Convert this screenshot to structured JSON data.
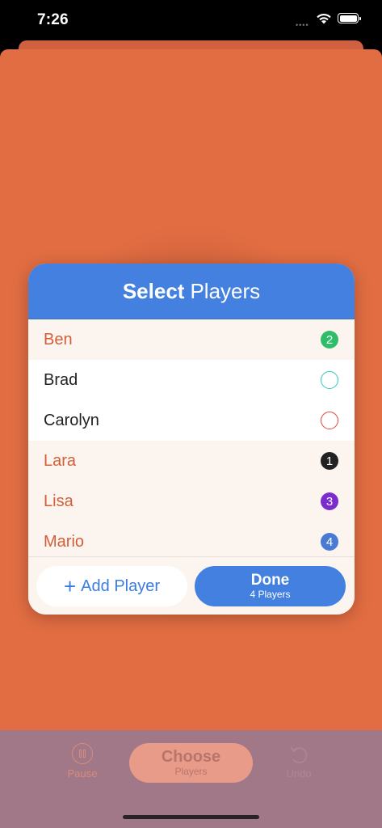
{
  "status": {
    "time": "7:26",
    "signal": "••••"
  },
  "dialog": {
    "title_bold": "Select",
    "title_rest": "Players",
    "players": [
      {
        "name": "Ben",
        "selected": true,
        "badge": "2",
        "badge_color": "#2ebd68"
      },
      {
        "name": "Brad",
        "selected": false,
        "badge": "",
        "badge_color": "#2fc9b8"
      },
      {
        "name": "Carolyn",
        "selected": false,
        "badge": "",
        "badge_color": "#d8443f"
      },
      {
        "name": "Lara",
        "selected": true,
        "badge": "1",
        "badge_color": "#222222"
      },
      {
        "name": "Lisa",
        "selected": true,
        "badge": "3",
        "badge_color": "#7b2ccf"
      },
      {
        "name": "Mario",
        "selected": true,
        "badge": "4",
        "badge_color": "#4a7bd4"
      }
    ],
    "add_player_label": "Add Player",
    "done_label": "Done",
    "done_sub": "4 Players"
  },
  "toolbar": {
    "pause_label": "Pause",
    "choose_label": "Choose",
    "choose_sub": "Players",
    "undo_label": "Undo"
  },
  "colors": {
    "background_card": "#e26d43",
    "accent_blue": "#4380e0",
    "bottom_bar": "#a17887"
  }
}
